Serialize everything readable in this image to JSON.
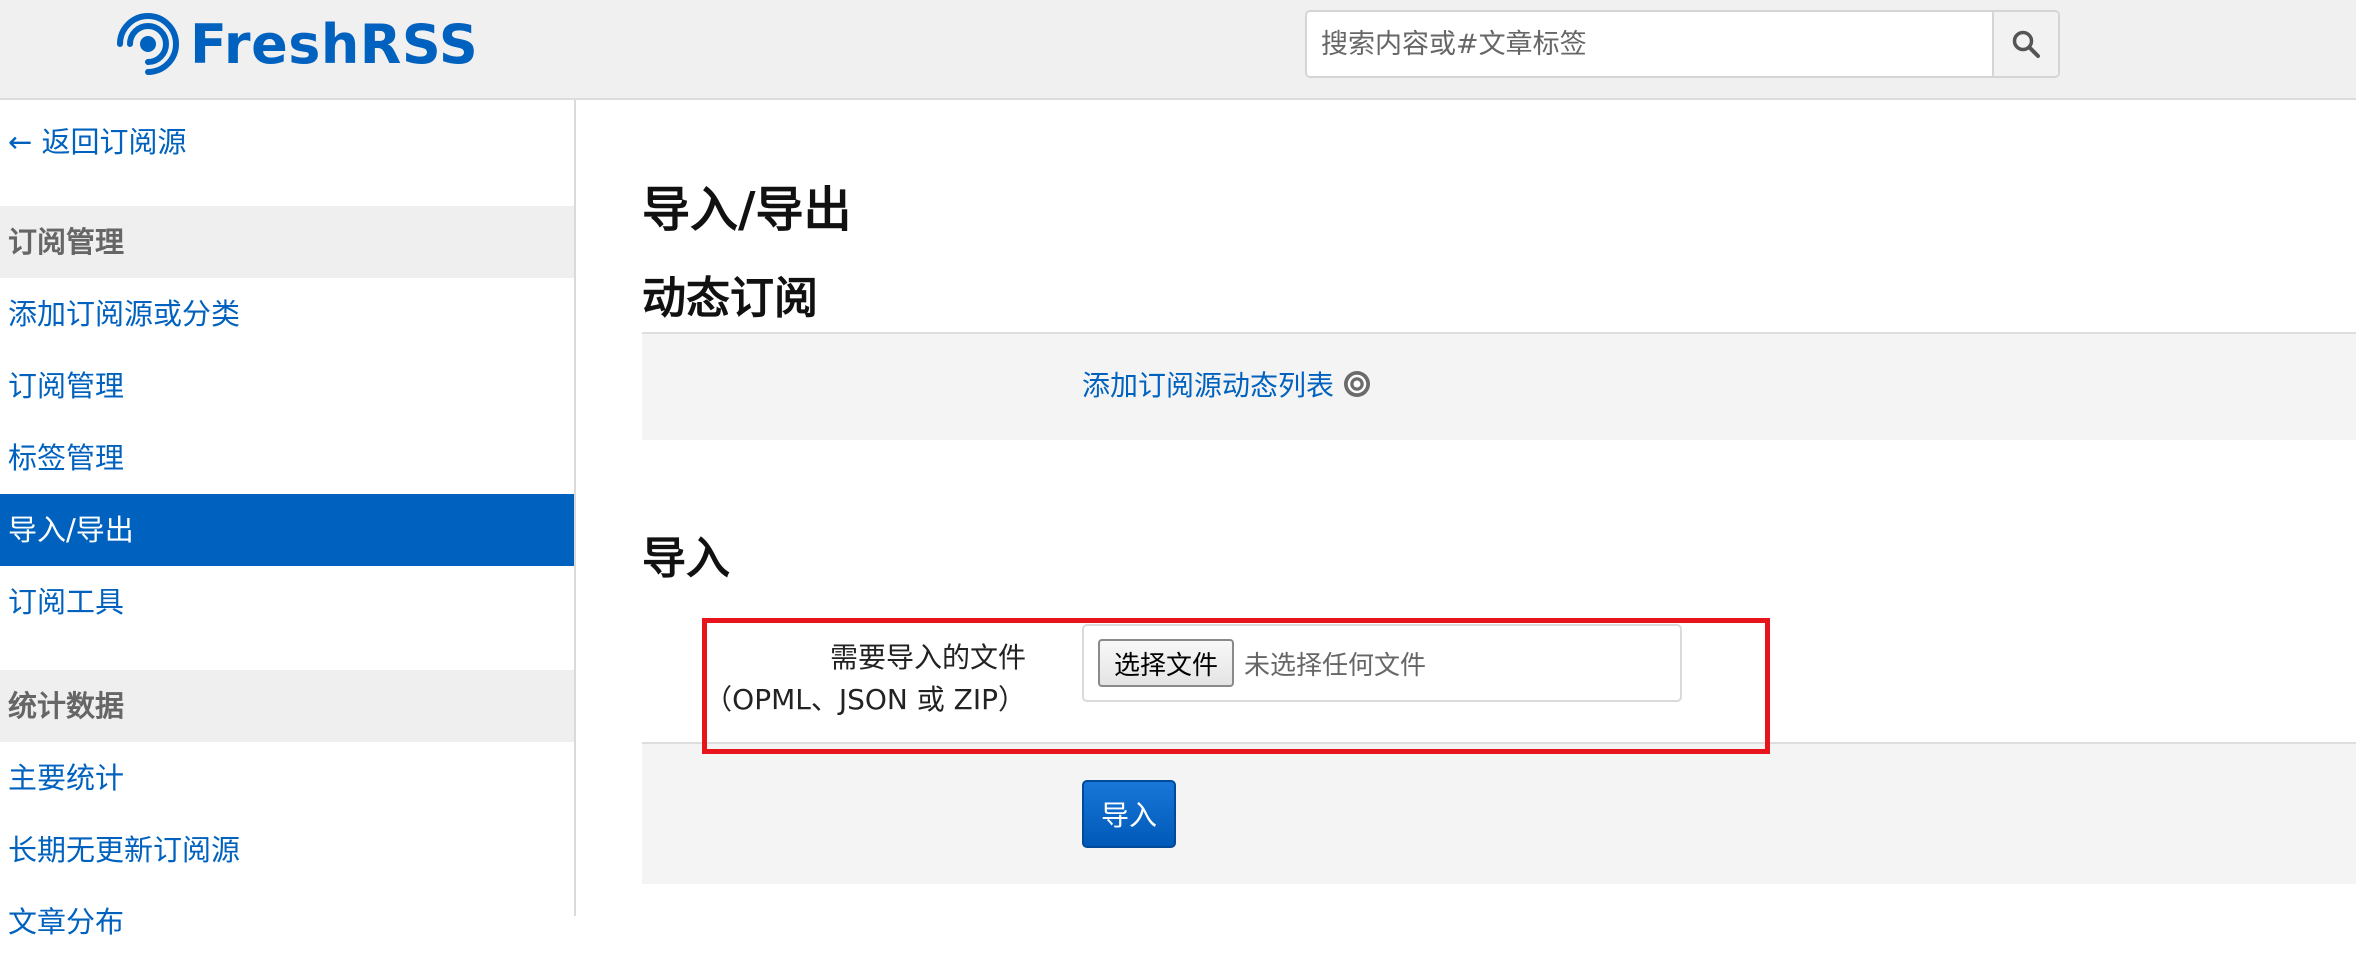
{
  "header": {
    "app_name": "FreshRSS",
    "search_placeholder": "搜索内容或#文章标签",
    "brand_color": "#0062be"
  },
  "sidebar": {
    "back_link": "← 返回订阅源",
    "sections": [
      {
        "heading": "订阅管理",
        "items": [
          {
            "label": "添加订阅源或分类",
            "active": false
          },
          {
            "label": "订阅管理",
            "active": false
          },
          {
            "label": "标签管理",
            "active": false
          },
          {
            "label": "导入/导出",
            "active": true
          },
          {
            "label": "订阅工具",
            "active": false
          }
        ]
      },
      {
        "heading": "统计数据",
        "items": [
          {
            "label": "主要统计",
            "active": false
          },
          {
            "label": "长期无更新订阅源",
            "active": false
          },
          {
            "label": "文章分布",
            "active": false
          }
        ]
      }
    ]
  },
  "main": {
    "title": "导入/导出",
    "dynamic": {
      "heading": "动态订阅",
      "link_label": "添加订阅源动态列表"
    },
    "import": {
      "heading": "导入",
      "file_label_line1": "需要导入的文件",
      "file_label_line2": "（OPML、JSON 或 ZIP）",
      "choose_file_label": "选择文件",
      "no_file_text": "未选择任何文件",
      "submit_label": "导入"
    }
  }
}
